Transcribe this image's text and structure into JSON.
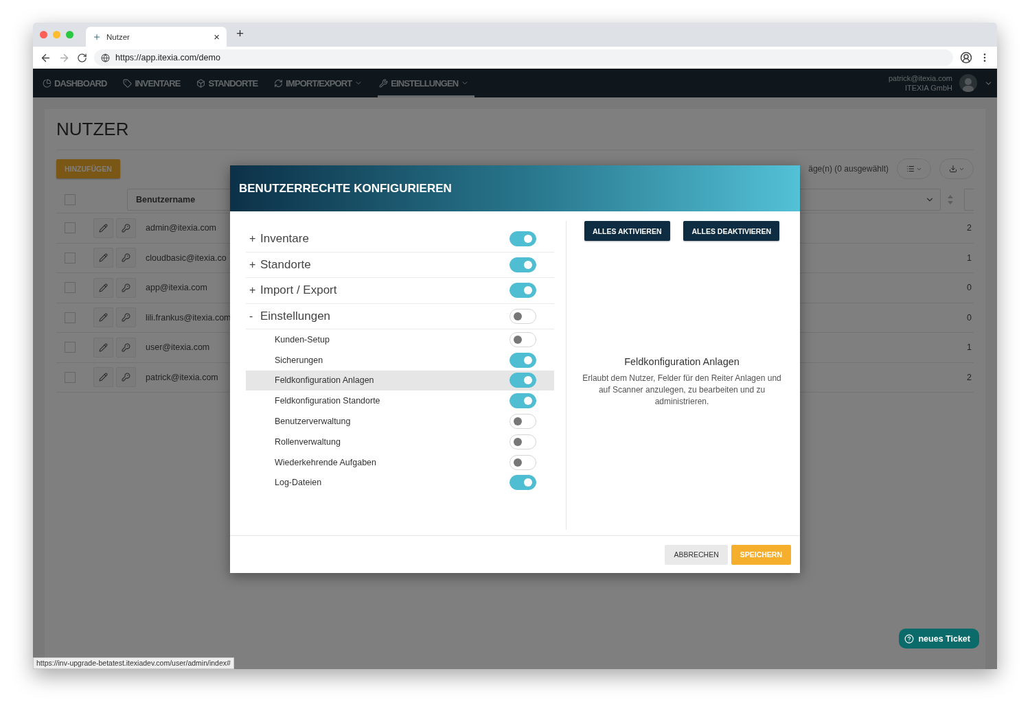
{
  "browser": {
    "tab_title": "Nutzer",
    "tab_close": "×",
    "new_tab": "+",
    "url": "https://app.itexia.com/demo",
    "status_url": "https://inv-upgrade-betatest.itexiadev.com/user/admin/index#"
  },
  "nav": {
    "items": [
      {
        "label": "DASHBOARD",
        "dropdown": false,
        "selected": false
      },
      {
        "label": "INVENTARE",
        "dropdown": false,
        "selected": false
      },
      {
        "label": "STANDORTE",
        "dropdown": false,
        "selected": false
      },
      {
        "label": "IMPORT/EXPORT",
        "dropdown": true,
        "selected": false
      },
      {
        "label": "EINSTELLUNGEN",
        "dropdown": true,
        "selected": true
      }
    ],
    "user": {
      "email": "patrick@itexia.com",
      "company": "ITEXIA GmbH"
    }
  },
  "page": {
    "title": "NUTZER",
    "add_button": "HINZUFÜGEN",
    "records_info": "äge(n) (0 ausgewählt)",
    "select_all_checked": false,
    "table": {
      "columns": [
        {
          "label": "Benutzername"
        }
      ],
      "rows": [
        {
          "username": "admin@itexia.com",
          "column_3": "2",
          "checked": false
        },
        {
          "username": "cloudbasic@itexia.co",
          "column_3": "1",
          "checked": false
        },
        {
          "username": "app@itexia.com",
          "column_3": "0",
          "checked": false
        },
        {
          "username": "lili.frankus@itexia.com",
          "column_3": "0",
          "checked": false
        },
        {
          "username": "user@itexia.com",
          "column_3": "1",
          "checked": false
        },
        {
          "username": "patrick@itexia.com",
          "column_3": "2",
          "checked": false
        }
      ]
    }
  },
  "modal": {
    "title": "BENUTZERRECHTE KONFIGURIEREN",
    "permissions": [
      {
        "marker": "+",
        "label": "Inventare",
        "on": true,
        "selected": false
      },
      {
        "marker": "+",
        "label": "Standorte",
        "on": true,
        "selected": false
      },
      {
        "marker": "+",
        "label": "Import / Export",
        "on": true,
        "selected": false
      },
      {
        "marker": "-",
        "label": "Einstellungen",
        "on": false,
        "selected": false,
        "children": [
          {
            "label": "Kunden-Setup",
            "on": false,
            "selected": false
          },
          {
            "label": "Sicherungen",
            "on": true,
            "selected": false
          },
          {
            "label": "Feldkonfiguration Anlagen",
            "on": true,
            "selected": true
          },
          {
            "label": "Feldkonfiguration Standorte",
            "on": true,
            "selected": false
          },
          {
            "label": "Benutzerverwaltung",
            "on": false,
            "selected": false
          },
          {
            "label": "Rollenverwaltung",
            "on": false,
            "selected": false
          },
          {
            "label": "Wiederkehrende Aufgaben",
            "on": false,
            "selected": false
          },
          {
            "label": "Log-Dateien",
            "on": true,
            "selected": false
          }
        ]
      }
    ],
    "bulk_buttons": [
      "ALLES AKTIVIEREN",
      "ALLES DEAKTIVIEREN"
    ],
    "detail": {
      "title": "Feldkonfiguration Anlagen",
      "text": "Erlaubt dem Nutzer, Felder für den Reiter Anlagen und auf Scanner anzulegen, zu bearbeiten und zu administrieren."
    },
    "footer_buttons": [
      {
        "label": "ABBRECHEN",
        "kind": "secondary"
      },
      {
        "label": "SPEICHERN",
        "kind": "primary"
      }
    ]
  },
  "help_button": "neues Ticket"
}
